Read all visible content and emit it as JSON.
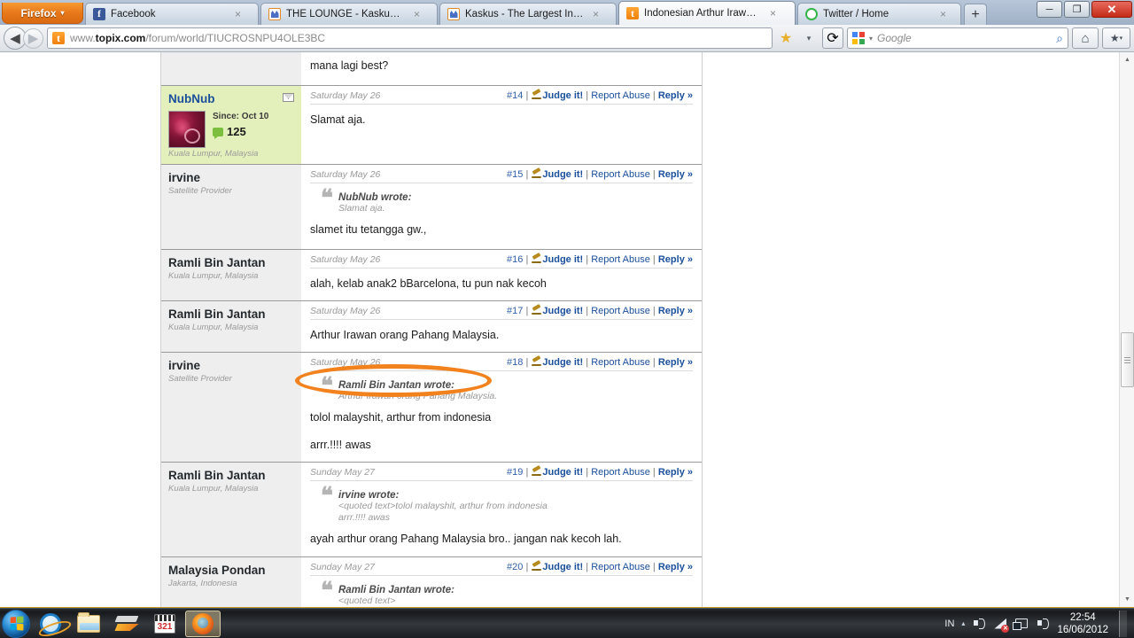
{
  "browser": {
    "menu_button_label": "Firefox",
    "menu_caret": "▾",
    "tabs": [
      {
        "label": "Facebook",
        "favicon": "facebook-icon",
        "active": false,
        "close": "×"
      },
      {
        "label": "THE LOUNGE - Kaskus - The La...",
        "favicon": "kaskus-icon",
        "active": false,
        "close": "×"
      },
      {
        "label": "Kaskus - The Largest Indonesia...",
        "favicon": "kaskus-icon",
        "active": false,
        "close": "×"
      },
      {
        "label": "Indonesian Arthur Irawan called...",
        "favicon": "topix-icon",
        "active": true,
        "close": "×"
      },
      {
        "label": "Twitter / Home",
        "favicon": "twitter-icon",
        "active": false,
        "close": "×"
      }
    ],
    "new_tab_label": "+",
    "window_controls": {
      "minimize": "─",
      "maximize": "❐",
      "close": "✕"
    },
    "nav": {
      "back": "◀",
      "forward": "▶",
      "url_prefix": "www.",
      "url_domain": "topix.com",
      "url_path": "/forum/world/TIUCROSNPU4OLE3BC",
      "favicon": "topix-icon",
      "bookmark_star": "★",
      "bookmark_caret": "▾",
      "reload": "⟳",
      "search_placeholder": "Google",
      "search_caret": "▾",
      "search_magnifier": "⌕",
      "home": "⌂",
      "bookmarks_button": "★",
      "bookmarks_caret": "▾"
    }
  },
  "forum": {
    "partial_top_post": {
      "text": "mana lagi best?"
    },
    "posts": [
      {
        "author": "NubNub",
        "author_is_link": true,
        "location": "Kuala Lumpur, Malaysia",
        "highlighted": true,
        "has_mail_icon": true,
        "since": "Since: Oct 10",
        "post_count": "125",
        "date": "Saturday May 26",
        "number": "#14",
        "judge_label": "Judge it!",
        "report_label": "Report Abuse",
        "reply_label": "Reply »",
        "quote": null,
        "text": "Slamat aja."
      },
      {
        "author": "irvine",
        "author_is_link": false,
        "location": "Satellite Provider",
        "highlighted": false,
        "has_mail_icon": false,
        "since": "",
        "post_count": "",
        "date": "Saturday May 26",
        "number": "#15",
        "judge_label": "Judge it!",
        "report_label": "Report Abuse",
        "reply_label": "Reply »",
        "quote": {
          "author": "NubNub wrote:",
          "lines": [
            "Slamat aja."
          ]
        },
        "text": "slamet itu tetangga gw.,"
      },
      {
        "author": "Ramli Bin Jantan",
        "author_is_link": false,
        "location": "Kuala Lumpur, Malaysia",
        "highlighted": false,
        "has_mail_icon": false,
        "since": "",
        "post_count": "",
        "date": "Saturday May 26",
        "number": "#16",
        "judge_label": "Judge it!",
        "report_label": "Report Abuse",
        "reply_label": "Reply »",
        "quote": null,
        "text": "alah, kelab anak2 bBarcelona, tu pun nak kecoh"
      },
      {
        "author": "Ramli Bin Jantan",
        "author_is_link": false,
        "location": "Kuala Lumpur, Malaysia",
        "highlighted": false,
        "has_mail_icon": false,
        "since": "",
        "post_count": "",
        "date": "Saturday May 26",
        "number": "#17",
        "judge_label": "Judge it!",
        "report_label": "Report Abuse",
        "reply_label": "Reply »",
        "quote": null,
        "text": "Arthur Irawan orang Pahang Malaysia."
      },
      {
        "author": "irvine",
        "author_is_link": false,
        "location": "Satellite Provider",
        "highlighted": false,
        "has_mail_icon": false,
        "since": "",
        "post_count": "",
        "date": "Saturday May 26",
        "number": "#18",
        "judge_label": "Judge it!",
        "report_label": "Report Abuse",
        "reply_label": "Reply »",
        "quote": {
          "author": "Ramli Bin Jantan wrote:",
          "lines": [
            "Arthur Irawan orang Pahang Malaysia."
          ]
        },
        "text": "tolol malayshit, arthur from indonesia",
        "text2": "arrr.!!!! awas"
      },
      {
        "author": "Ramli Bin Jantan",
        "author_is_link": false,
        "location": "Kuala Lumpur, Malaysia",
        "highlighted": false,
        "has_mail_icon": false,
        "since": "",
        "post_count": "",
        "date": "Sunday May 27",
        "number": "#19",
        "judge_label": "Judge it!",
        "report_label": "Report Abuse",
        "reply_label": "Reply »",
        "quote": {
          "author": "irvine wrote:",
          "lines": [
            "<quoted text>tolol malayshit, arthur from indonesia",
            "arrr.!!!! awas"
          ]
        },
        "text": "ayah arthur orang Pahang Malaysia bro.. jangan nak kecoh lah."
      },
      {
        "author": "Malaysia Pondan",
        "author_is_link": false,
        "location": "Jakarta, Indonesia",
        "highlighted": false,
        "has_mail_icon": false,
        "since": "",
        "post_count": "",
        "date": "Sunday May 27",
        "number": "#20",
        "judge_label": "Judge it!",
        "report_label": "Report Abuse",
        "reply_label": "Reply »",
        "quote": {
          "author": "Ramli Bin Jantan wrote:",
          "lines": [
            "<quoted text>"
          ]
        },
        "text": ""
      }
    ],
    "annotation": {
      "shape": "ellipse",
      "color": "#f2821e",
      "targets": "Arthur Irawan orang Pahang Malaysia."
    }
  },
  "scrollbar": {
    "up": "▲",
    "down": "▼"
  },
  "taskbar": {
    "start_label": "Start",
    "items": [
      {
        "name": "internet-explorer",
        "active": false
      },
      {
        "name": "windows-explorer",
        "active": false
      },
      {
        "name": "winamp",
        "active": false
      },
      {
        "name": "klite-codec",
        "active": false,
        "label": "321"
      },
      {
        "name": "firefox",
        "active": true
      }
    ],
    "tray": {
      "language": "IN",
      "caret": "▴",
      "time": "22:54",
      "date": "16/06/2012"
    }
  }
}
